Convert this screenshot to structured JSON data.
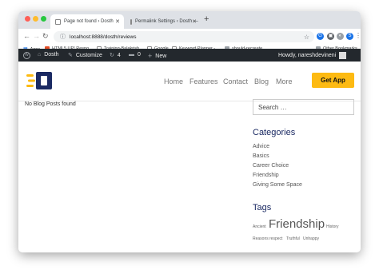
{
  "browser": {
    "tabs": [
      {
        "label": "Page not found › Dosth"
      },
      {
        "label": "Permalink Settings ‹ Dosth —"
      }
    ],
    "new_tab": "+",
    "url": "localhost:8888/dosth/reviews",
    "bookmarks": [
      {
        "label": "Apps"
      },
      {
        "label": "HTML5 UP! Respo..."
      },
      {
        "label": "Training-Balakrish..."
      },
      {
        "label": "Google"
      },
      {
        "label": "Keyword Planner -..."
      },
      {
        "label": "should-recreate"
      },
      {
        "label": "Other Bookmarks"
      }
    ]
  },
  "adminbar": {
    "site_name": "Dosth",
    "customize": "Customize",
    "updates": "4",
    "comments": "0",
    "new": "New",
    "howdy": "Howdy, nareshdevineni"
  },
  "header": {
    "logo_letter": "D",
    "nav": [
      "Home",
      "Features",
      "Contact",
      "Blog",
      "More"
    ],
    "cta": "Get App"
  },
  "main": {
    "message": "No Blog Posts found"
  },
  "sidebar": {
    "search_placeholder": "Search …",
    "categories_title": "Categories",
    "categories": [
      "Advice",
      "Basics",
      "Career Choice",
      "Friendship",
      "Giving Some Space"
    ],
    "tags_title": "Tags",
    "tags": [
      "Ancient",
      "Friendship",
      "History",
      "Reasons",
      "respect",
      "Truthful",
      "Unhappy"
    ]
  },
  "colors": {
    "admin_bar": "#23282d",
    "cta": "#fdba12",
    "widget_title": "#1b2a63",
    "logo_blue": "#1b2a63",
    "logo_yellow": "#fdba12"
  }
}
